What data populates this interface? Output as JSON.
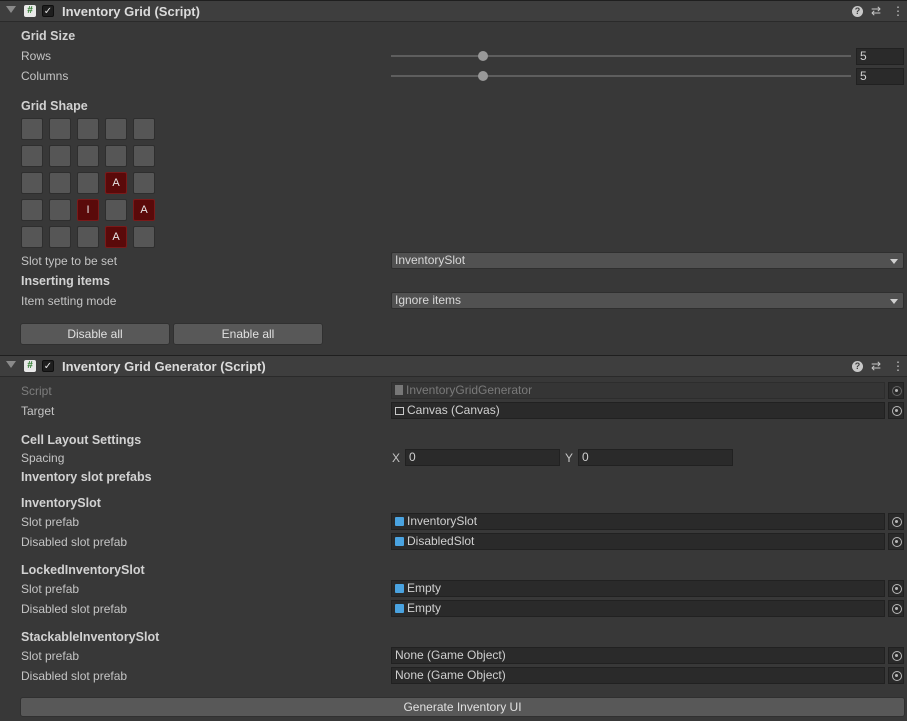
{
  "inventory_grid": {
    "title": "Inventory Grid (Script)",
    "grid_size_label": "Grid Size",
    "rows_label": "Rows",
    "rows_value": "5",
    "rows_fraction": 0.2,
    "columns_label": "Columns",
    "columns_value": "5",
    "columns_fraction": 0.2,
    "grid_shape_label": "Grid Shape",
    "grid": [
      [
        "",
        "",
        "",
        "",
        ""
      ],
      [
        "",
        "",
        "",
        "",
        ""
      ],
      [
        "",
        "",
        "",
        "A",
        ""
      ],
      [
        "",
        "",
        "I",
        "",
        "A"
      ],
      [
        "",
        "",
        "",
        "A",
        ""
      ]
    ],
    "slot_type_label": "Slot type to be set",
    "slot_type_value": "InventorySlot",
    "inserting_items_label": "Inserting items",
    "item_setting_mode_label": "Item setting mode",
    "item_setting_mode_value": "Ignore items",
    "disable_all_label": "Disable all",
    "enable_all_label": "Enable all"
  },
  "generator": {
    "title": "Inventory Grid Generator (Script)",
    "script_label": "Script",
    "script_value": "InventoryGridGenerator",
    "target_label": "Target",
    "target_value": "Canvas (Canvas)",
    "cell_layout_label": "Cell Layout Settings",
    "spacing_label": "Spacing",
    "spacing_x_label": "X",
    "spacing_x_value": "0",
    "spacing_y_label": "Y",
    "spacing_y_value": "0",
    "prefabs_label": "Inventory slot prefabs",
    "groups": [
      {
        "name": "InventorySlot",
        "slot_label": "Slot prefab",
        "slot_value": "InventorySlot",
        "disabled_label": "Disabled slot prefab",
        "disabled_value": "DisabledSlot"
      },
      {
        "name": "LockedInventorySlot",
        "slot_label": "Slot prefab",
        "slot_value": "Empty",
        "disabled_label": "Disabled slot prefab",
        "disabled_value": "Empty"
      },
      {
        "name": "StackableInventorySlot",
        "slot_label": "Slot prefab",
        "slot_value": "None (Game Object)",
        "disabled_label": "Disabled slot prefab",
        "disabled_value": "None (Game Object)"
      }
    ],
    "generate_label": "Generate Inventory UI"
  },
  "icons": {
    "checkmark": "✓",
    "script": "#",
    "help": "?",
    "presets": "⇄",
    "menu": "⋮"
  },
  "colors": {
    "background": "#383838",
    "header": "#3e3e3e",
    "active_cell": "#5a0a0a",
    "prefab_icon": "#4aa3e0"
  }
}
